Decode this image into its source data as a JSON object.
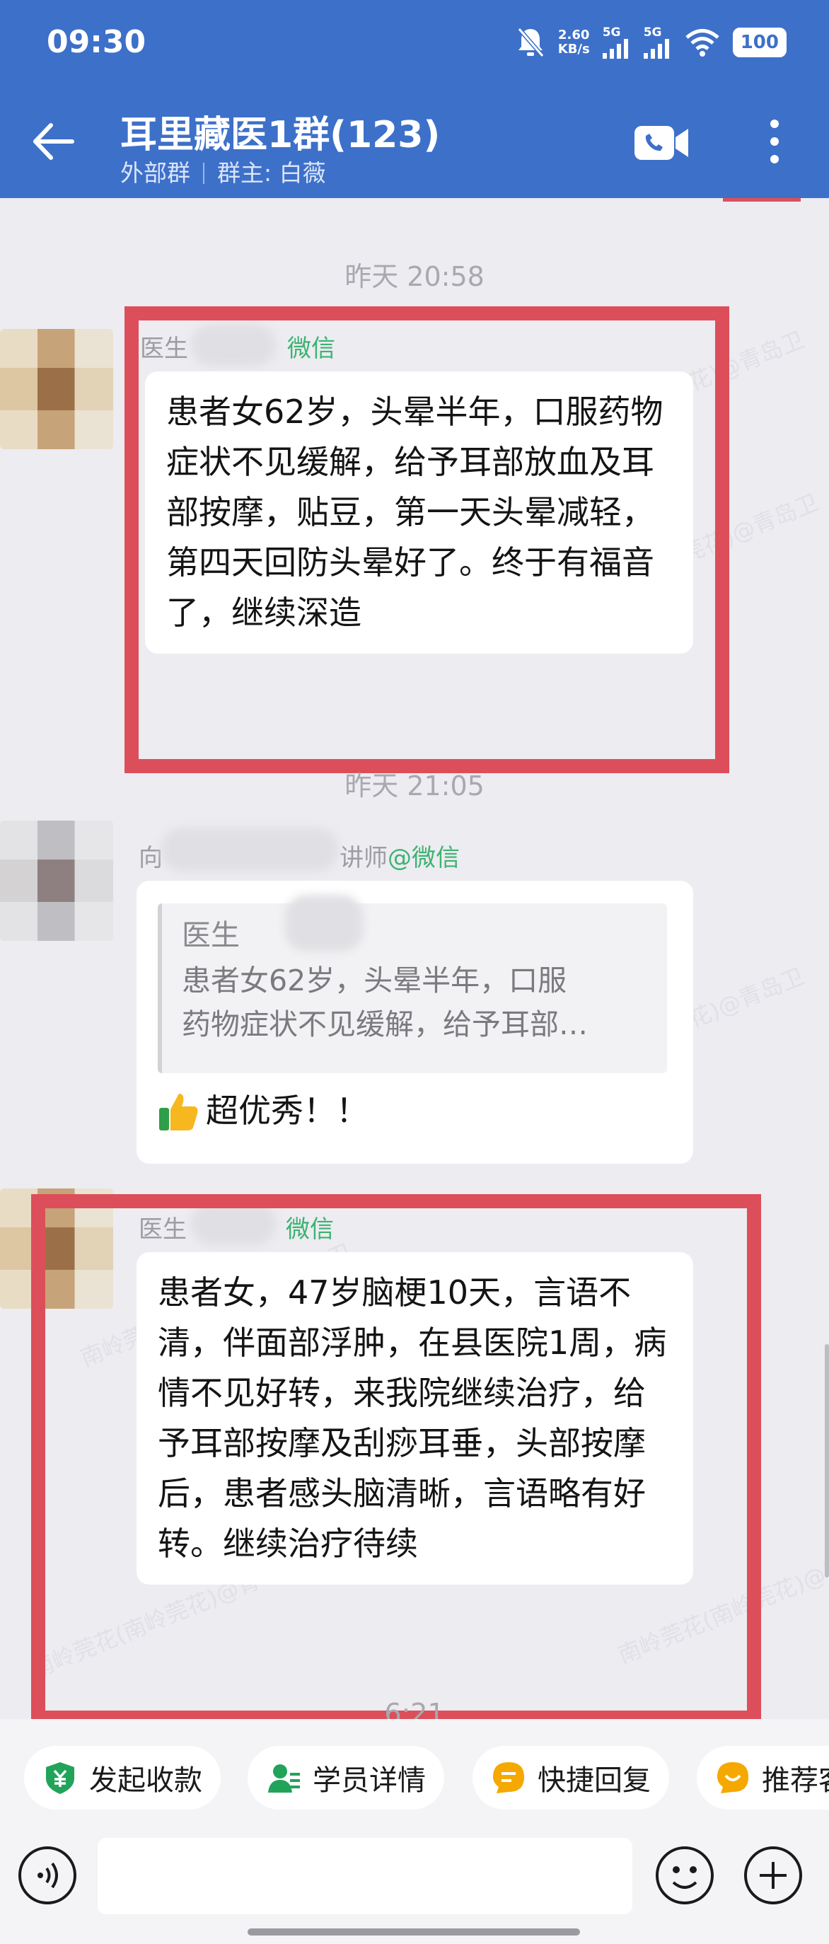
{
  "status_bar": {
    "time": "09:30",
    "speed_value": "2.60",
    "speed_unit": "KB/s",
    "net1": "5G",
    "net2": "5G",
    "battery": "100"
  },
  "header": {
    "title": "耳里藏医1群(123)",
    "subtitle_type": "外部群",
    "subtitle_owner": "群主: 白薇"
  },
  "messages": [
    {
      "time": "昨天  20:58",
      "sender_prefix": "医生",
      "sender_tag": "微信",
      "text": "患者女62岁，头晕半年，口服药物症状不见缓解，给予耳部放血及耳部按摩，贴豆，第一天头晕减轻，第四天回防头晕好了。终于有福音了，继续深造"
    },
    {
      "time": "昨天  21:05",
      "sender_prefix": "向",
      "sender_suffix": "讲师",
      "sender_tag": "@微信",
      "quote_sender": "医生",
      "quote_line1": "患者女62岁，头晕半年，口服",
      "quote_line2": "药物症状不见缓解，给予耳部…",
      "reply": "超优秀！！"
    },
    {
      "sender_prefix": "医生",
      "sender_tag": "微信",
      "text": "患者女，47岁脑梗10天，言语不清，伴面部浮肿，在县医院1周，病情不见好转，来我院继续治疗，给予耳部按摩及刮痧耳垂，头部按摩后，患者感头脑清晰，言语略有好转。继续治疗待续"
    }
  ],
  "partial_time": "6:21",
  "quick_actions": [
    {
      "label": "发起收款",
      "icon": "payment-icon",
      "color": "#21a35a"
    },
    {
      "label": "学员详情",
      "icon": "student-icon",
      "color": "#21a35a"
    },
    {
      "label": "快捷回复",
      "icon": "quick-reply-icon",
      "color": "#f5a800"
    },
    {
      "label": "推荐客",
      "icon": "recommend-icon",
      "color": "#f5a800"
    }
  ],
  "input": {
    "placeholder": ""
  },
  "colors": {
    "header_bg": "#3d70c9",
    "highlight_frame": "#dc4f5a",
    "wechat_tag": "#3cb371"
  },
  "watermark_text": "南岭莞花(南岭莞花)@青岛卫"
}
